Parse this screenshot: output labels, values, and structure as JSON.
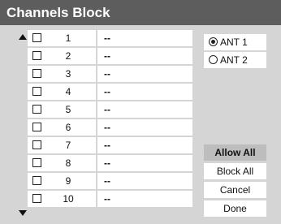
{
  "window": {
    "title": "Channels Block"
  },
  "channels": [
    {
      "number": "1",
      "name": "--",
      "checked": false
    },
    {
      "number": "2",
      "name": "--",
      "checked": false
    },
    {
      "number": "3",
      "name": "--",
      "checked": false
    },
    {
      "number": "4",
      "name": "--",
      "checked": false
    },
    {
      "number": "5",
      "name": "--",
      "checked": false
    },
    {
      "number": "6",
      "name": "--",
      "checked": false
    },
    {
      "number": "7",
      "name": "--",
      "checked": false
    },
    {
      "number": "8",
      "name": "--",
      "checked": false
    },
    {
      "number": "9",
      "name": "--",
      "checked": false
    },
    {
      "number": "10",
      "name": "--",
      "checked": false
    }
  ],
  "antenna": {
    "options": [
      {
        "label": "ANT 1",
        "selected": true
      },
      {
        "label": "ANT 2",
        "selected": false
      }
    ]
  },
  "buttons": {
    "allow_all": "Allow All",
    "block_all": "Block All",
    "cancel": "Cancel",
    "done": "Done"
  },
  "colors": {
    "title_bar": "#5d5d5d",
    "panel_background": "#d5d5d5",
    "active_button": "#bdbdbd"
  },
  "icons": {
    "scroll_up": "triangle-up-icon",
    "scroll_down": "triangle-down-icon"
  }
}
